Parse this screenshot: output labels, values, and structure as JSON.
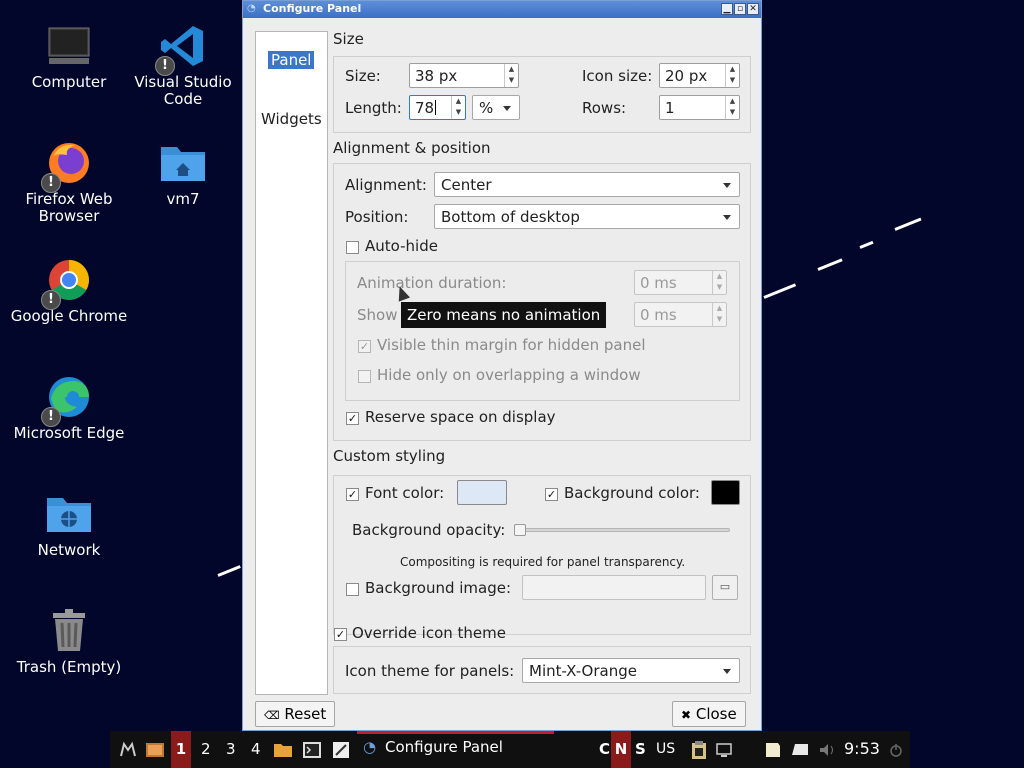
{
  "desktop": {
    "icons": [
      {
        "label": "Computer",
        "icon": "computer-icon"
      },
      {
        "label": "Visual Studio Code",
        "icon": "vscode-icon"
      },
      {
        "label": "Firefox Web Browser",
        "icon": "firefox-icon"
      },
      {
        "label": "vm7",
        "icon": "home-folder-icon"
      },
      {
        "label": "Google Chrome",
        "icon": "chrome-icon"
      },
      {
        "label": "Microsoft Edge",
        "icon": "edge-icon"
      },
      {
        "label": "Network",
        "icon": "network-folder-icon"
      },
      {
        "label": "Trash (Empty)",
        "icon": "trash-icon"
      }
    ],
    "badge_glyph": "!"
  },
  "dialog": {
    "title": "Configure Panel",
    "sidebar": [
      "Panel",
      "Widgets"
    ],
    "size": {
      "title": "Size",
      "size_label": "Size:",
      "size_value": "38 px",
      "length_label": "Length:",
      "length_value": "78",
      "length_unit": "%",
      "icon_size_label": "Icon size:",
      "icon_size_value": "20 px",
      "rows_label": "Rows:",
      "rows_value": "1"
    },
    "alignment": {
      "title": "Alignment & position",
      "alignment_label": "Alignment:",
      "alignment_value": "Center",
      "position_label": "Position:",
      "position_value": "Bottom of desktop",
      "autohide_label": "Auto-hide",
      "autohide_checked": false,
      "anim_label": "Animation duration:",
      "anim_value": "0 ms",
      "show_label": "Show",
      "show_value": "0 ms",
      "tooltip": "Zero means no animation",
      "thin_margin_label": "Visible thin margin for hidden panel",
      "thin_margin_checked": true,
      "overlap_label": "Hide only on overlapping a window",
      "overlap_checked": false,
      "reserve_label": "Reserve space on display",
      "reserve_checked": true
    },
    "styling": {
      "title": "Custom styling",
      "font_color_label": "Font color:",
      "font_color_checked": true,
      "font_color": "#dce8f5",
      "bg_color_label": "Background color:",
      "bg_color_checked": true,
      "bg_color": "#000000",
      "opacity_label": "Background opacity:",
      "opacity_value": 0,
      "compositing_note": "Compositing is required for panel transparency.",
      "bg_image_label": "Background image:",
      "bg_image_checked": false,
      "bg_image_value": ""
    },
    "icon_theme": {
      "override_label": "Override icon theme",
      "override_checked": true,
      "theme_label": "Icon theme for panels:",
      "theme_value": "Mint-X-Orange"
    },
    "buttons": {
      "reset": "Reset",
      "close": "Close"
    }
  },
  "taskbar": {
    "workspaces": [
      "1",
      "2",
      "3",
      "4"
    ],
    "active_workspace": "1",
    "window_title": "Configure Panel",
    "indicators": [
      "C",
      "N",
      "S"
    ],
    "keyboard_layout": "US",
    "clock": "9:53",
    "active_color": "#8b1a1a"
  },
  "check_glyph": "✓"
}
